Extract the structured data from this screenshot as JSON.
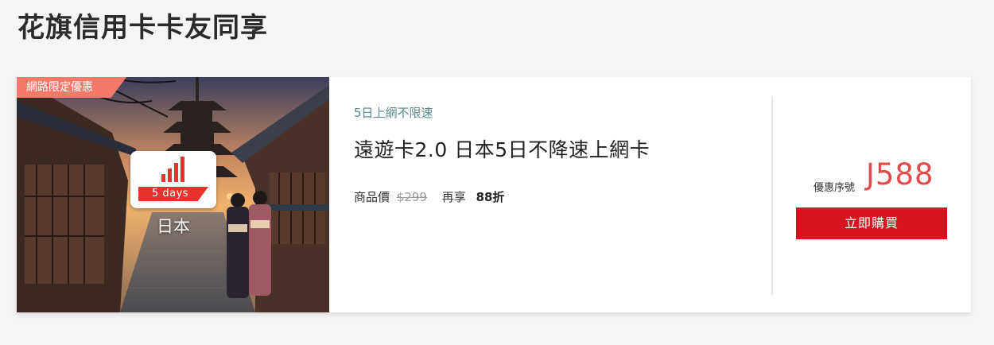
{
  "page": {
    "title": "花旗信用卡卡友同享"
  },
  "offer": {
    "ribbon": "網路限定優惠",
    "badge_days": "5 days",
    "country": "日本",
    "subtitle": "5日上網不限速",
    "title": "遠遊卡2.0 日本5日不降速上網卡",
    "price_label": "商品價",
    "original_price": "$299",
    "share_label": "再享",
    "discount": "88折",
    "code_label": "優惠序號",
    "code": "J588",
    "buy_label": "立即購買"
  },
  "colors": {
    "ribbon": "#f4796b",
    "code": "#e34a4a",
    "buy_button": "#d6141f",
    "subtitle": "#5a8a8f"
  },
  "icons": {
    "signal": "signal-bars-icon"
  }
}
